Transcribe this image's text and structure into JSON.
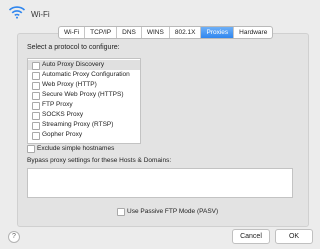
{
  "header": {
    "title": "Wi-Fi",
    "icon": "wifi-icon"
  },
  "tabs": [
    {
      "label": "Wi-Fi"
    },
    {
      "label": "TCP/IP"
    },
    {
      "label": "DNS"
    },
    {
      "label": "WINS"
    },
    {
      "label": "802.1X"
    },
    {
      "label": "Proxies",
      "active": true
    },
    {
      "label": "Hardware"
    }
  ],
  "protocols": {
    "label": "Select a protocol to configure:",
    "items": [
      {
        "label": "Auto Proxy Discovery",
        "checked": false,
        "selected": true
      },
      {
        "label": "Automatic Proxy Configuration",
        "checked": false
      },
      {
        "label": "Web Proxy (HTTP)",
        "checked": false
      },
      {
        "label": "Secure Web Proxy (HTTPS)",
        "checked": false
      },
      {
        "label": "FTP Proxy",
        "checked": false
      },
      {
        "label": "SOCKS Proxy",
        "checked": false
      },
      {
        "label": "Streaming Proxy (RTSP)",
        "checked": false
      },
      {
        "label": "Gopher Proxy",
        "checked": false
      }
    ]
  },
  "exclude_simple": {
    "label": "Exclude simple hostnames",
    "checked": false
  },
  "bypass": {
    "label": "Bypass proxy settings for these Hosts & Domains:",
    "value": ""
  },
  "passive_ftp": {
    "label": "Use Passive FTP Mode (PASV)",
    "checked": false
  },
  "buttons": {
    "help": "?",
    "cancel": "Cancel",
    "ok": "OK"
  }
}
